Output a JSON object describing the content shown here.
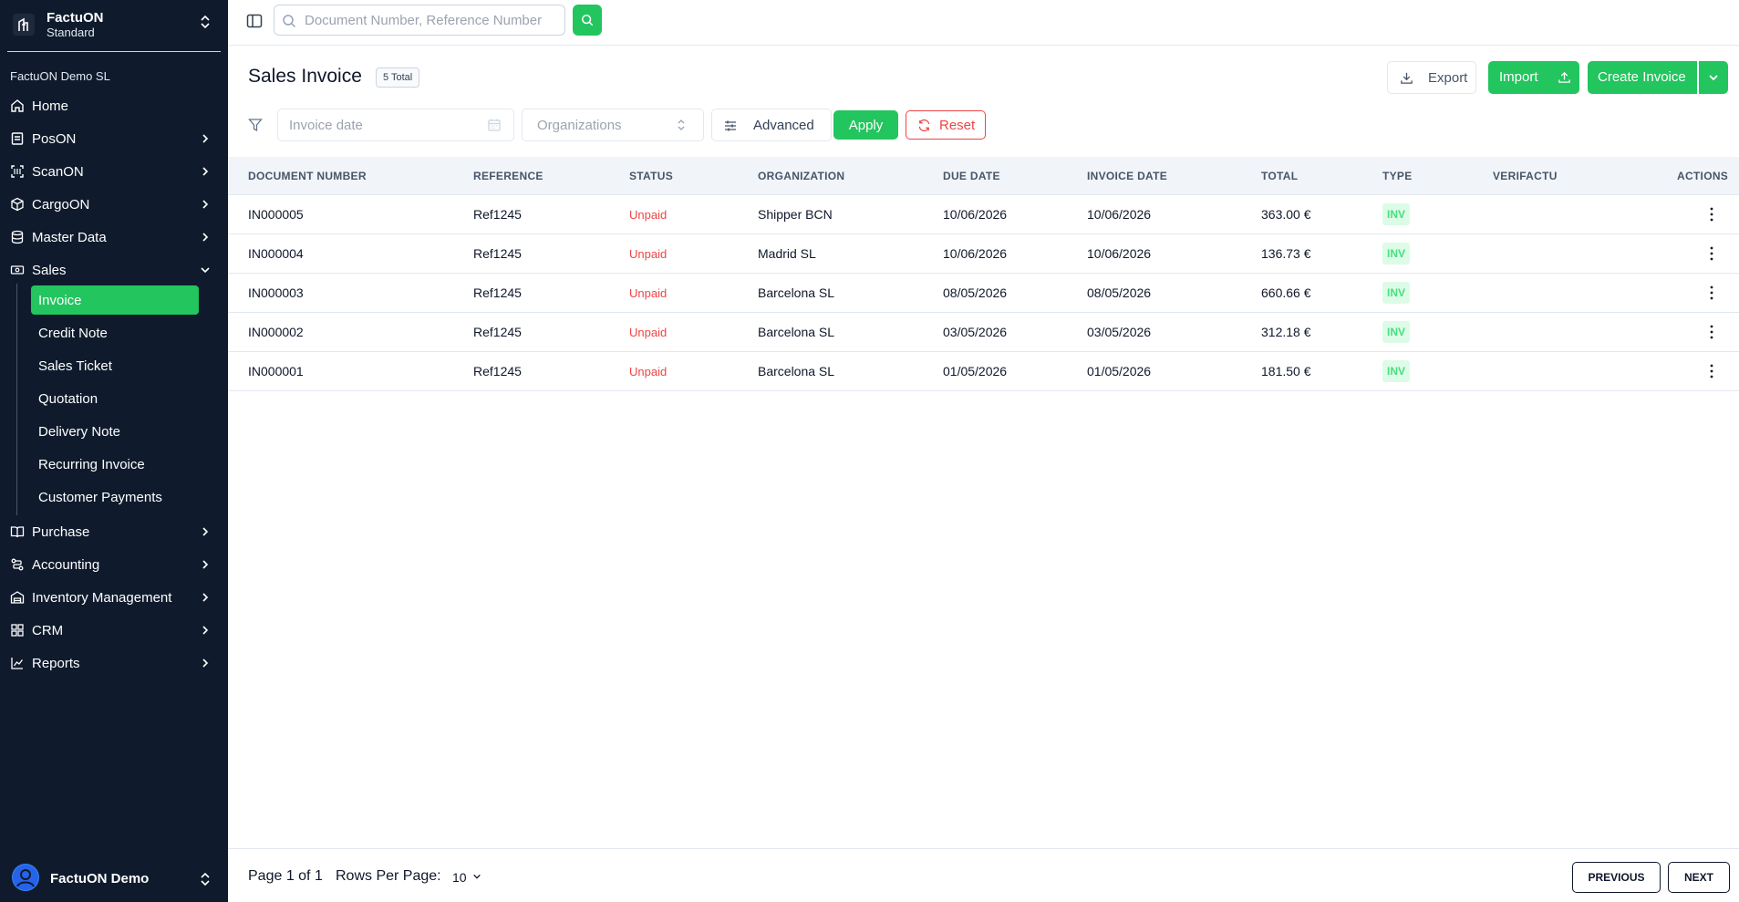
{
  "brand": {
    "name": "FactuON",
    "plan": "Standard"
  },
  "company": "FactuON Demo SL",
  "nav": {
    "home": "Home",
    "poson": "PosON",
    "scanon": "ScanON",
    "cargoon": "CargoON",
    "master_data": "Master Data",
    "sales": "Sales",
    "sales_sub": {
      "invoice": "Invoice",
      "credit_note": "Credit Note",
      "sales_ticket": "Sales Ticket",
      "quotation": "Quotation",
      "delivery_note": "Delivery Note",
      "recurring_invoice": "Recurring Invoice",
      "customer_payments": "Customer Payments"
    },
    "purchase": "Purchase",
    "accounting": "Accounting",
    "inventory": "Inventory Management",
    "crm": "CRM",
    "reports": "Reports"
  },
  "user": {
    "name": "FactuON Demo"
  },
  "search": {
    "placeholder": "Document Number, Reference Number"
  },
  "page": {
    "title": "Sales Invoice",
    "total_badge": "5 Total"
  },
  "toolbar": {
    "export": "Export",
    "import": "Import",
    "create": "Create Invoice"
  },
  "filters": {
    "date_placeholder": "Invoice date",
    "org_placeholder": "Organizations",
    "advanced": "Advanced",
    "apply": "Apply",
    "reset": "Reset"
  },
  "table": {
    "columns": [
      "DOCUMENT NUMBER",
      "REFERENCE",
      "STATUS",
      "ORGANIZATION",
      "DUE DATE",
      "INVOICE DATE",
      "TOTAL",
      "TYPE",
      "VERIFACTU",
      "ACTIONS"
    ],
    "rows": [
      {
        "doc": "IN000005",
        "ref": "Ref1245",
        "status": "Unpaid",
        "org": "Shipper BCN",
        "due": "10/06/2026",
        "inv_date": "10/06/2026",
        "total": "363.00 €",
        "type": "INV",
        "verifactu": ""
      },
      {
        "doc": "IN000004",
        "ref": "Ref1245",
        "status": "Unpaid",
        "org": "Madrid SL",
        "due": "10/06/2026",
        "inv_date": "10/06/2026",
        "total": "136.73 €",
        "type": "INV",
        "verifactu": ""
      },
      {
        "doc": "IN000003",
        "ref": "Ref1245",
        "status": "Unpaid",
        "org": "Barcelona SL",
        "due": "08/05/2026",
        "inv_date": "08/05/2026",
        "total": "660.66 €",
        "type": "INV",
        "verifactu": ""
      },
      {
        "doc": "IN000002",
        "ref": "Ref1245",
        "status": "Unpaid",
        "org": "Barcelona SL",
        "due": "03/05/2026",
        "inv_date": "03/05/2026",
        "total": "312.18 €",
        "type": "INV",
        "verifactu": ""
      },
      {
        "doc": "IN000001",
        "ref": "Ref1245",
        "status": "Unpaid",
        "org": "Barcelona SL",
        "due": "01/05/2026",
        "inv_date": "01/05/2026",
        "total": "181.50 €",
        "type": "INV",
        "verifactu": ""
      }
    ]
  },
  "pagination": {
    "page_info": "Page 1 of 1",
    "rows_per_page_label": "Rows Per Page:",
    "rows_per_page": "10",
    "previous": "PREVIOUS",
    "next": "NEXT"
  },
  "colors": {
    "sidebar_bg": "#0f1b2d",
    "accent": "#22c55e",
    "danger": "#ef4444",
    "type_badge_bg": "#dcfce7"
  }
}
